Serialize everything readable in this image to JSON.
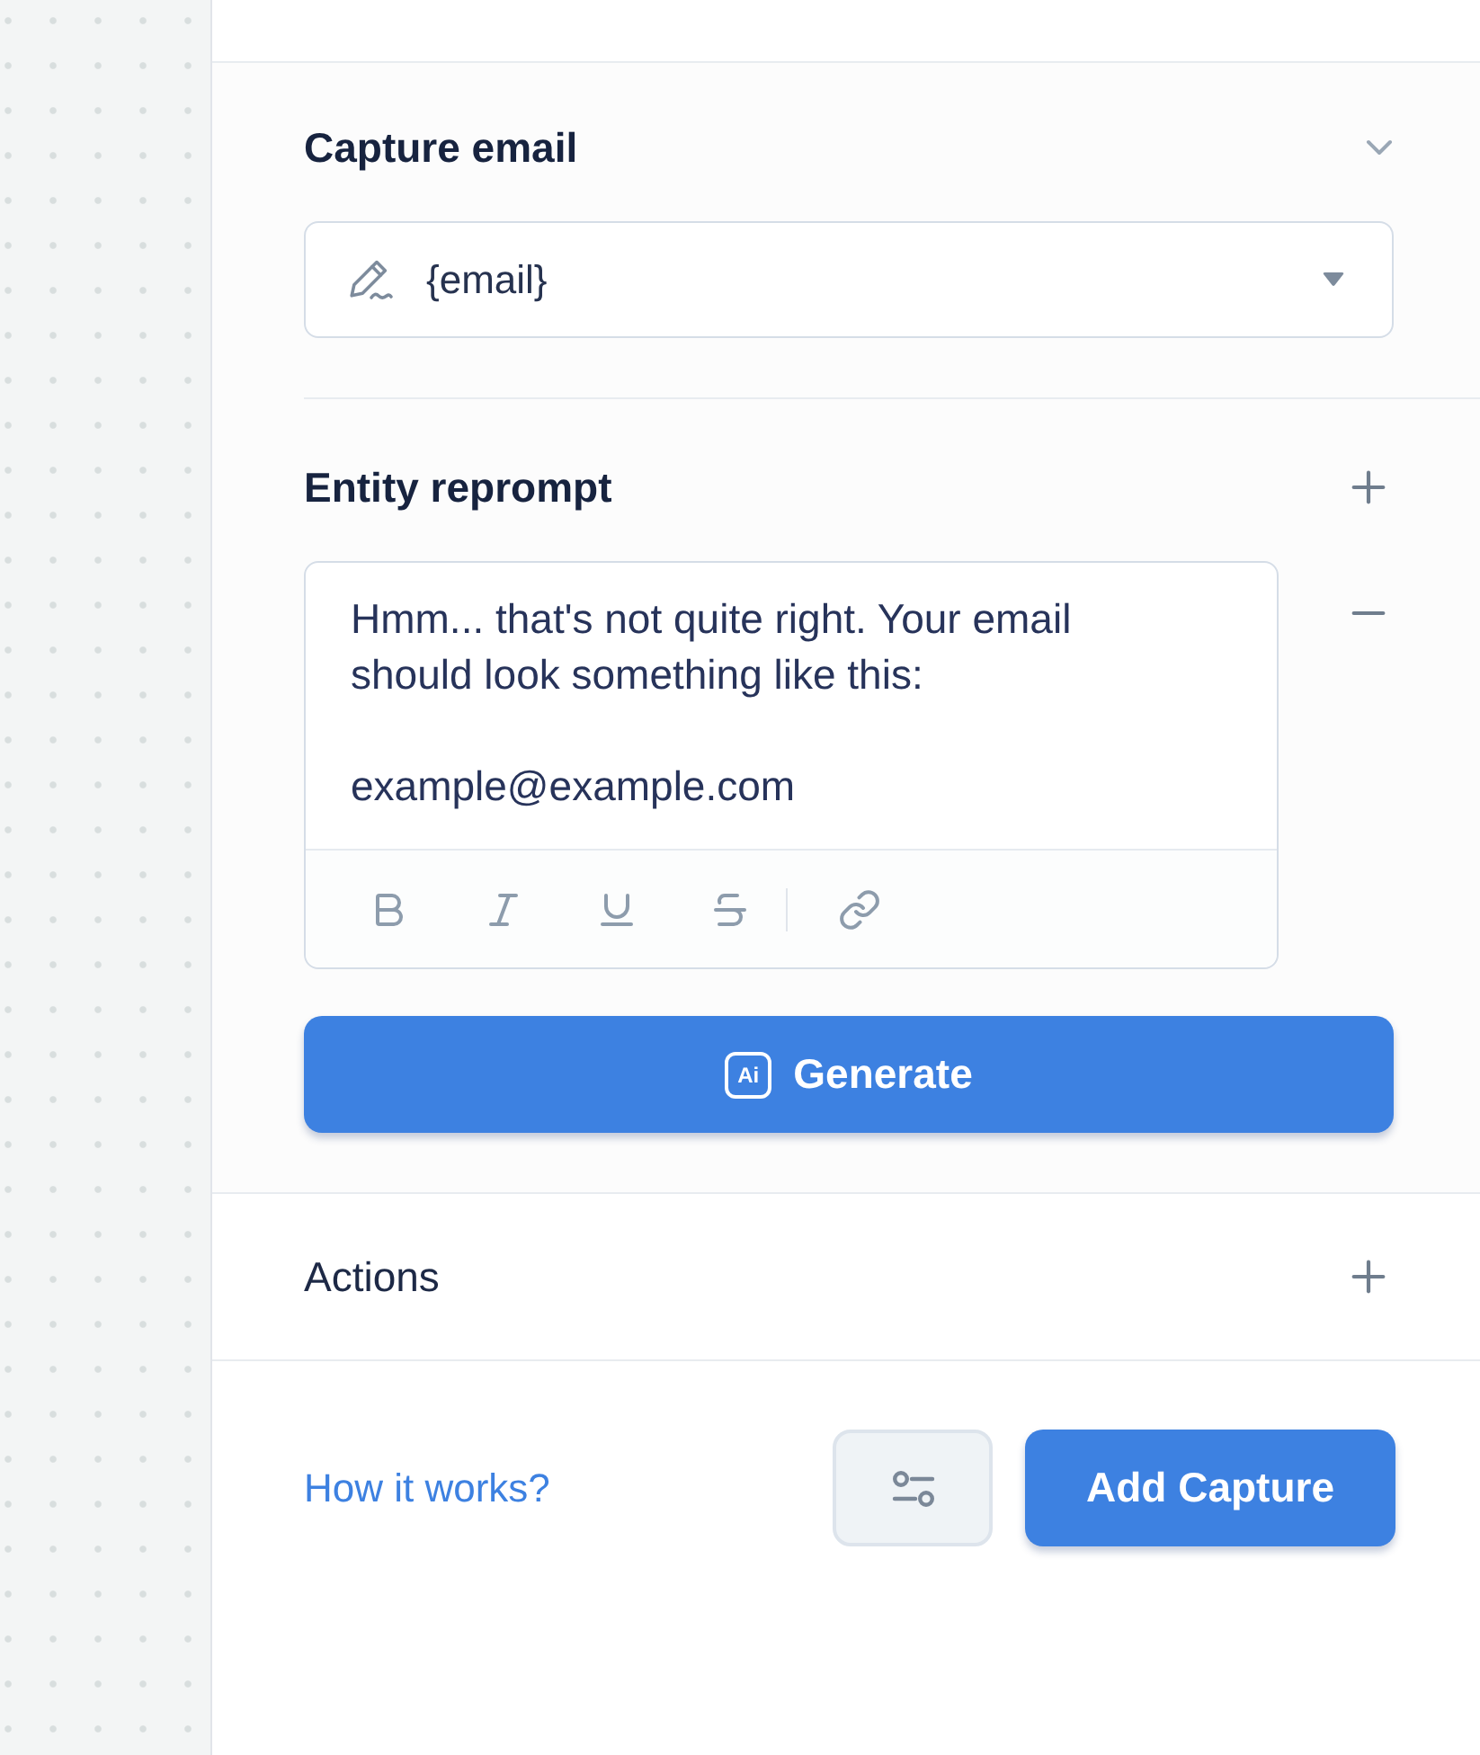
{
  "capture_section": {
    "title": "Capture email",
    "expanded": true,
    "variable_select": {
      "value": "{email}"
    }
  },
  "reprompt_section": {
    "title": "Entity reprompt",
    "reprompts": [
      {
        "paragraphs": [
          "Hmm... that's not quite right. Your email should look something like this:",
          "example@example.com"
        ]
      }
    ],
    "generate_button": {
      "badge": "Ai",
      "label": "Generate"
    }
  },
  "actions_section": {
    "title": "Actions"
  },
  "footer": {
    "help_link": "How it works?",
    "primary_button": "Add Capture"
  }
}
